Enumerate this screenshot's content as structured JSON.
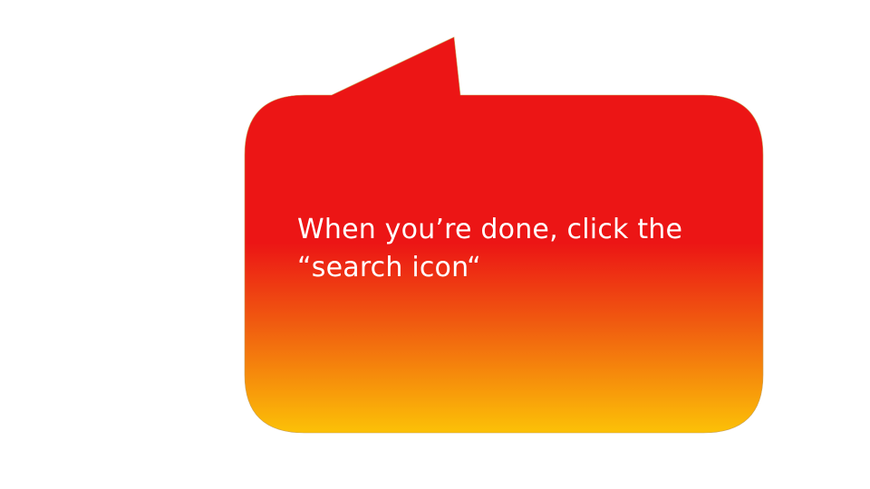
{
  "callout": {
    "line1": "When you’re done, click the",
    "line2": "“search icon“"
  },
  "colors": {
    "gradient_top": "#EC1515",
    "gradient_mid": "#EC1515",
    "gradient_bottom": "#FCC107",
    "text": "#FFFFFF",
    "background": "#FFFFFF"
  }
}
